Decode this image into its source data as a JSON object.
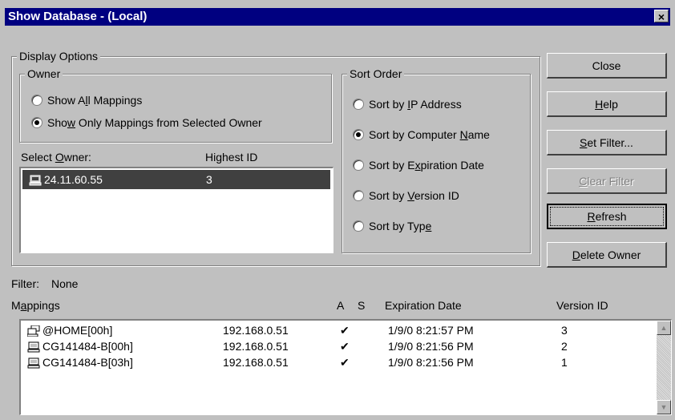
{
  "window": {
    "title": "Show Database - (Local)",
    "close_glyph": "×"
  },
  "display_options": {
    "legend": "Display Options",
    "owner": {
      "legend": "Owner",
      "show_all_pre": "Show A",
      "show_all_u": "l",
      "show_all_post": "l Mappings",
      "show_only_pre": "Sho",
      "show_only_u": "w",
      "show_only_post": " Only Mappings from Selected Owner"
    },
    "select_owner_pre": "Select ",
    "select_owner_u": "O",
    "select_owner_post": "wner:",
    "highest_id_header": "Highest ID",
    "owner_rows": [
      {
        "address": "24.11.60.55",
        "highest_id": "3"
      }
    ]
  },
  "sort_order": {
    "legend": "Sort Order",
    "options": [
      {
        "pre": "Sort by ",
        "u": "I",
        "post": "P Address",
        "selected": false
      },
      {
        "pre": "Sort by Computer ",
        "u": "N",
        "post": "ame",
        "selected": true
      },
      {
        "pre": "Sort by E",
        "u": "x",
        "post": "piration Date",
        "selected": false
      },
      {
        "pre": "Sort by ",
        "u": "V",
        "post": "ersion ID",
        "selected": false
      },
      {
        "pre": "Sort by Typ",
        "u": "e",
        "post": "",
        "selected": false
      }
    ]
  },
  "buttons": {
    "close": "Close",
    "help_u": "H",
    "help_post": "elp",
    "set_filter_u": "S",
    "set_filter_post": "et Filter...",
    "clear_filter_u": "C",
    "clear_filter_post": "lear Filter",
    "refresh_u": "R",
    "refresh_post": "efresh",
    "delete_owner_u": "D",
    "delete_owner_post": "elete Owner"
  },
  "filter": {
    "label": "Filter:",
    "value": "None"
  },
  "mappings": {
    "header_pre": "M",
    "header_u": "a",
    "header_post": "ppings",
    "col_a": "A",
    "col_s": "S",
    "col_expiration": "Expiration Date",
    "col_version": "Version ID",
    "rows": [
      {
        "name": "@HOME[00h]",
        "ip": "192.168.0.51",
        "a": "✔",
        "s": "",
        "expiration": "1/9/0 8:21:57 PM",
        "version": "3",
        "icon": "group-computers-icon"
      },
      {
        "name": "CG141484-B[00h]",
        "ip": "192.168.0.51",
        "a": "✔",
        "s": "",
        "expiration": "1/9/0 8:21:56 PM",
        "version": "2",
        "icon": "computer-icon"
      },
      {
        "name": "CG141484-B[03h]",
        "ip": "192.168.0.51",
        "a": "✔",
        "s": "",
        "expiration": "1/9/0 8:21:56 PM",
        "version": "1",
        "icon": "computer-icon"
      }
    ]
  },
  "scroll": {
    "up_glyph": "▲",
    "down_glyph": "▼"
  }
}
